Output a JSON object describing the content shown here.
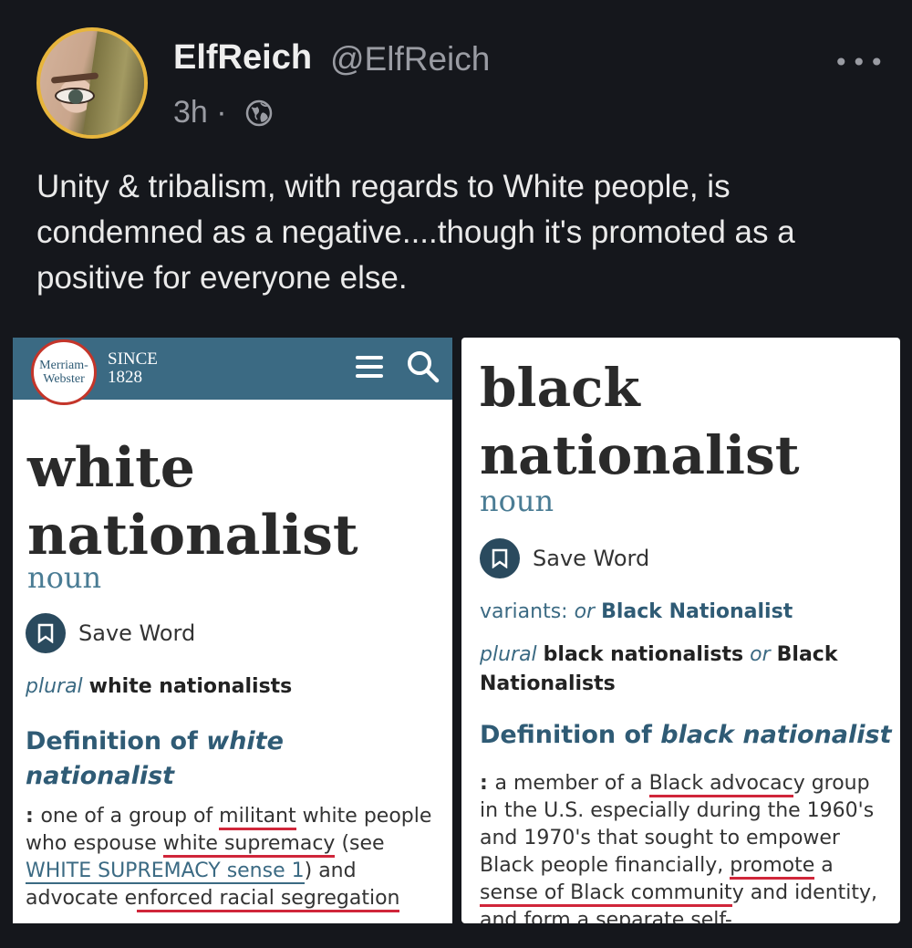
{
  "post": {
    "display_name": "ElfReich",
    "handle": "@ElfReich",
    "time": "3h ·",
    "more_icon": "more-dots-icon",
    "visibility_icon": "globe-icon",
    "text": "Unity & tribalism, with regards to White people, is condemned as a negative....though it's promoted as a positive for everyone else."
  },
  "left_card": {
    "logo_line1": "Merriam-",
    "logo_line2": "Webster",
    "since_line1": "SINCE",
    "since_line2": "1828",
    "headword_line1": "white",
    "headword_line2": "nationalist",
    "pos": "noun",
    "save_label": "Save Word",
    "plural_label": "plural",
    "plural_form": "white nationalists",
    "def_title_prefix": "Definition of ",
    "def_title_term": "white nationalist",
    "def_colon": ": ",
    "def_parts": [
      "one of a group of ",
      "militant",
      " white people who espouse ",
      "white supremacy",
      " (see ",
      "WHITE SUPREMACY sense 1",
      ") and advocate e",
      "nforced racial segregation"
    ]
  },
  "right_card": {
    "headword_line1": "black",
    "headword_line2": "nationalist",
    "pos": "noun",
    "save_label": "Save Word",
    "variants_label": "variants: ",
    "variants_or": "or",
    "variant_form": "Black Nationalist",
    "plural_label": "plural",
    "plural_form1": "black nationalists",
    "plural_or": "or",
    "plural_form2": "Black Nationalists",
    "def_title_prefix": "Definition of ",
    "def_title_term": "black nationalist",
    "def_colon": ": ",
    "def_parts": [
      "a member of a ",
      "Black advocac",
      "y group in the U.S. especially during the 1960's and 1970's that sought to empower Black people financially, ",
      "promote",
      " a ",
      "sense of Black communit",
      "y and identity, and form a separate self-"
    ]
  },
  "colors": {
    "background": "#15171c",
    "avatar_ring": "#e7b53c",
    "mw_blue": "#3b6a83",
    "underline_red": "#d0263a"
  }
}
